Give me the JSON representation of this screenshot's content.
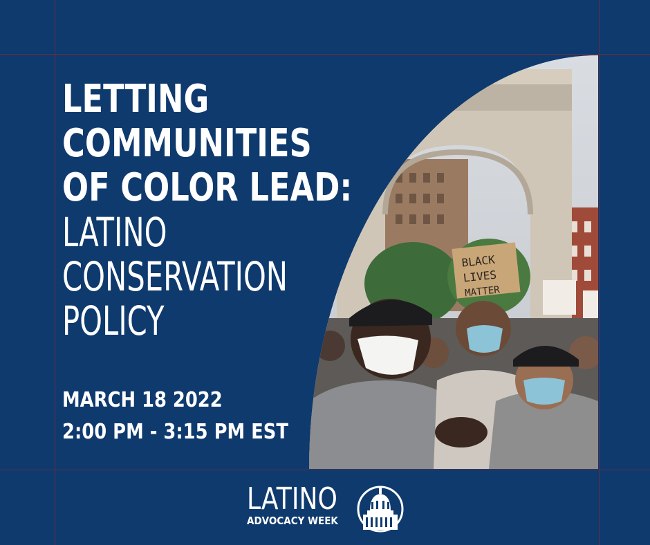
{
  "headline": {
    "line1": "LETTING",
    "line2": "COMMUNITIES",
    "line3": "OF COLOR LEAD:",
    "line4": "LATINO",
    "line5": "CONSERVATION",
    "line6": "POLICY"
  },
  "event": {
    "date": "MARCH 18 2022",
    "time": "2:00 PM - 3:15 PM EST"
  },
  "logo": {
    "word": "LATINO",
    "sub": "ADVOCACY WEEK"
  },
  "photo": {
    "sign_text": "BLACK LIVES MATTER",
    "icon": "protest-photo"
  },
  "colors": {
    "background": "#0f3a6e",
    "text": "#ffffff",
    "guides": "#7a2a3a"
  }
}
